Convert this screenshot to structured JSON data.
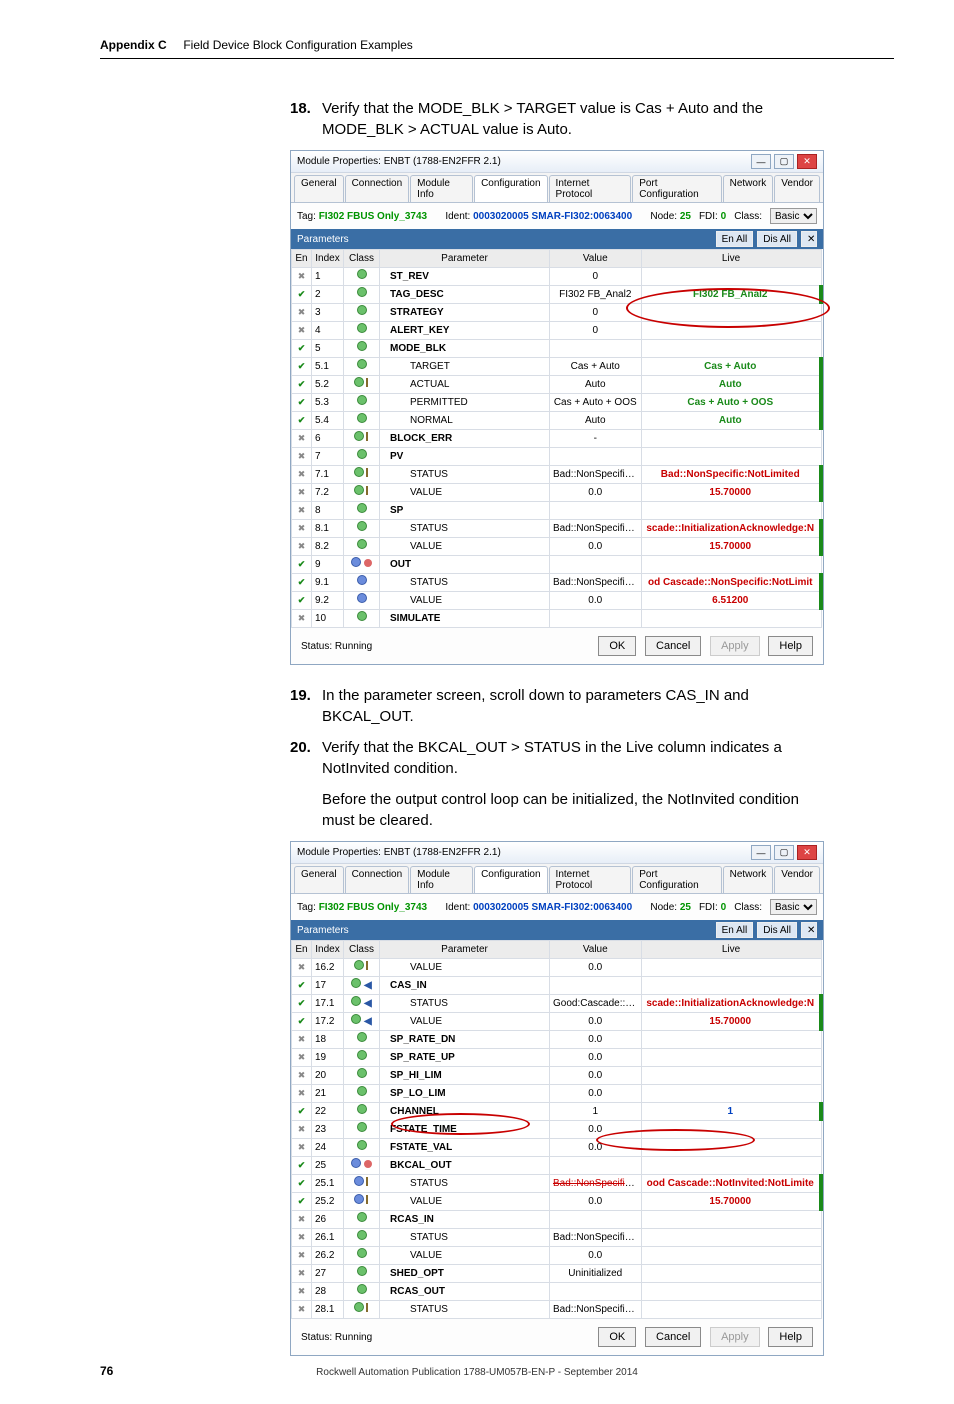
{
  "pageHeader": {
    "appendix": "Appendix C",
    "title": "Field Device Block Configuration Examples"
  },
  "steps": {
    "s18": {
      "num": "18.",
      "text": "Verify that the MODE_BLK > TARGET value is Cas + Auto and the MODE_BLK > ACTUAL value is Auto."
    },
    "s19": {
      "num": "19.",
      "text": "In the parameter screen, scroll down to parameters CAS_IN and BKCAL_OUT."
    },
    "s20": {
      "num": "20.",
      "text": "Verify that the BKCAL_OUT > STATUS in the Live column indicates a NotInvited condition."
    },
    "between": "Before the output control loop can be initialized, the NotInvited condition must be cleared."
  },
  "windowTitle": "Module Properties: ENBT (1788-EN2FFR 2.1)",
  "tabs": [
    "General",
    "Connection",
    "Module Info",
    "Configuration",
    "Internet Protocol",
    "Port Configuration",
    "Network",
    "Vendor"
  ],
  "activeTab": "Configuration",
  "tagBar": {
    "tagLabel": "Tag:",
    "tagValue": "FI302 FBUS Only_3743",
    "identLabel": "Ident:",
    "identValue": "0003020005 SMAR-FI302:0063400",
    "nodeLabel": "Node:",
    "nodeValue": "25",
    "fdiLabel": "FDI:",
    "fdiValue": "0",
    "classLabel": "Class:",
    "classValue": "Basic"
  },
  "paramHeader": {
    "label": "Parameters",
    "enAll": "En All",
    "disAll": "Dis All"
  },
  "gridHeaders": {
    "en": "En",
    "index": "Index",
    "class": "Class",
    "parameter": "Parameter",
    "value": "Value",
    "live": "Live"
  },
  "rows1": [
    {
      "en": "x",
      "idx": "1",
      "cls": "bi",
      "p": "ST_REV",
      "bold": true,
      "indent": 1,
      "val": "0",
      "live": ""
    },
    {
      "en": "v",
      "idx": "2",
      "cls": "bi",
      "p": "TAG_DESC",
      "bold": true,
      "indent": 1,
      "val": "FI302 FB_Anal2",
      "live": "FI302 FB_Anal2",
      "liveCls": "green",
      "bar": true
    },
    {
      "en": "x",
      "idx": "3",
      "cls": "bi",
      "p": "STRATEGY",
      "bold": true,
      "indent": 1,
      "val": "0",
      "live": ""
    },
    {
      "en": "x",
      "idx": "4",
      "cls": "bi",
      "p": "ALERT_KEY",
      "bold": true,
      "indent": 1,
      "val": "0",
      "live": ""
    },
    {
      "en": "v",
      "idx": "5",
      "cls": "bi",
      "p": "MODE_BLK",
      "bold": true,
      "indent": 1,
      "val": "",
      "live": ""
    },
    {
      "en": "v",
      "idx": "5.1",
      "cls": "bi",
      "p": "TARGET",
      "indent": 2,
      "sub": true,
      "val": "Cas + Auto",
      "live": "Cas + Auto",
      "liveCls": "green",
      "bar": true
    },
    {
      "en": "v",
      "idx": "5.2",
      "cls": "bi",
      "p": "ACTUAL",
      "indent": 2,
      "sub": true,
      "pp": true,
      "val": "Auto",
      "live": "Auto",
      "liveCls": "green",
      "bar": true
    },
    {
      "en": "v",
      "idx": "5.3",
      "cls": "bi",
      "p": "PERMITTED",
      "indent": 2,
      "sub": true,
      "val": "Cas + Auto + OOS",
      "live": "Cas + Auto + OOS",
      "liveCls": "green",
      "bar": true
    },
    {
      "en": "v",
      "idx": "5.4",
      "cls": "bi",
      "p": "NORMAL",
      "indent": 2,
      "sub": true,
      "val": "Auto",
      "live": "Auto",
      "liveCls": "green",
      "bar": true
    },
    {
      "en": "x",
      "idx": "6",
      "cls": "bi",
      "p": "BLOCK_ERR",
      "bold": true,
      "indent": 1,
      "pp": true,
      "val": "-",
      "live": ""
    },
    {
      "en": "x",
      "idx": "7",
      "cls": "bi",
      "p": "PV",
      "bold": true,
      "indent": 1,
      "val": "",
      "live": ""
    },
    {
      "en": "x",
      "idx": "7.1",
      "cls": "bi",
      "p": "STATUS",
      "indent": 2,
      "sub": true,
      "pp": true,
      "val": "Bad::NonSpecific:NotLimited",
      "live": "Bad::NonSpecific:NotLimited",
      "liveCls": "red",
      "bar": true
    },
    {
      "en": "x",
      "idx": "7.2",
      "cls": "bi",
      "p": "VALUE",
      "indent": 2,
      "sub": true,
      "pp": true,
      "val": "0.0",
      "live": "15.70000",
      "liveCls": "red",
      "bar": true
    },
    {
      "en": "x",
      "idx": "8",
      "cls": "bi",
      "p": "SP",
      "bold": true,
      "indent": 1,
      "val": "",
      "live": ""
    },
    {
      "en": "x",
      "idx": "8.1",
      "cls": "bi",
      "p": "STATUS",
      "indent": 2,
      "sub": true,
      "val": "Bad::NonSpecific:NotLimited",
      "live": "scade::InitializationAcknowledge:N",
      "liveCls": "red",
      "bar": true
    },
    {
      "en": "x",
      "idx": "8.2",
      "cls": "bi",
      "p": "VALUE",
      "indent": 2,
      "sub": true,
      "val": "0.0",
      "live": "15.70000",
      "liveCls": "red",
      "bar": true
    },
    {
      "en": "v",
      "idx": "9",
      "cls": "bo",
      "p": "OUT",
      "bold": true,
      "indent": 1,
      "rc": true,
      "val": "",
      "live": ""
    },
    {
      "en": "v",
      "idx": "9.1",
      "cls": "bo",
      "p": "STATUS",
      "indent": 2,
      "sub": true,
      "val": "Bad::NonSpecific:NotLimited",
      "live": "od Cascade::NonSpecific:NotLimit",
      "liveCls": "red",
      "bar": true
    },
    {
      "en": "v",
      "idx": "9.2",
      "cls": "bo",
      "p": "VALUE",
      "indent": 2,
      "sub": true,
      "val": "0.0",
      "live": "6.51200",
      "liveCls": "red",
      "bar": true
    },
    {
      "en": "x",
      "idx": "10",
      "cls": "bi",
      "p": "SIMULATE",
      "bold": true,
      "indent": 1,
      "val": "",
      "live": ""
    }
  ],
  "rows2": [
    {
      "en": "x",
      "idx": "16.2",
      "cls": "bi",
      "p": "VALUE",
      "indent": 2,
      "sub": true,
      "pp": true,
      "val": "0.0",
      "live": ""
    },
    {
      "en": "v",
      "idx": "17",
      "cls": "bib",
      "p": "CAS_IN",
      "bold": true,
      "indent": 1,
      "val": "",
      "live": ""
    },
    {
      "en": "v",
      "idx": "17.1",
      "cls": "bib",
      "p": "STATUS",
      "indent": 2,
      "sub": true,
      "val": "Good:Cascade::NonSpecific:NotLimited",
      "live": "scade::InitializationAcknowledge:N",
      "liveCls": "red",
      "bar": true
    },
    {
      "en": "v",
      "idx": "17.2",
      "cls": "bib",
      "p": "VALUE",
      "indent": 2,
      "sub": true,
      "val": "0.0",
      "live": "15.70000",
      "liveCls": "red",
      "bar": true
    },
    {
      "en": "x",
      "idx": "18",
      "cls": "bi",
      "p": "SP_RATE_DN",
      "bold": true,
      "indent": 1,
      "val": "0.0",
      "live": ""
    },
    {
      "en": "x",
      "idx": "19",
      "cls": "bi",
      "p": "SP_RATE_UP",
      "bold": true,
      "indent": 1,
      "val": "0.0",
      "live": ""
    },
    {
      "en": "x",
      "idx": "20",
      "cls": "bi",
      "p": "SP_HI_LIM",
      "bold": true,
      "indent": 1,
      "val": "0.0",
      "live": ""
    },
    {
      "en": "x",
      "idx": "21",
      "cls": "bi",
      "p": "SP_LO_LIM",
      "bold": true,
      "indent": 1,
      "val": "0.0",
      "live": ""
    },
    {
      "en": "v",
      "idx": "22",
      "cls": "bi",
      "p": "CHANNEL",
      "bold": true,
      "indent": 1,
      "val": "1",
      "live": "1",
      "liveCls": "blue",
      "bar": true
    },
    {
      "en": "x",
      "idx": "23",
      "cls": "bi",
      "p": "FSTATE_TIME",
      "bold": true,
      "indent": 1,
      "val": "0.0",
      "live": ""
    },
    {
      "en": "x",
      "idx": "24",
      "cls": "bi",
      "p": "FSTATE_VAL",
      "bold": true,
      "indent": 1,
      "val": "0.0",
      "live": ""
    },
    {
      "en": "v",
      "idx": "25",
      "cls": "bo",
      "p": "BKCAL_OUT",
      "bold": true,
      "indent": 1,
      "rc": true,
      "val": "",
      "live": ""
    },
    {
      "en": "v",
      "idx": "25.1",
      "cls": "bo",
      "p": "STATUS",
      "indent": 2,
      "sub": true,
      "pp": true,
      "val": "Bad::NonSpecific:NotLim",
      "strike": true,
      "live": "ood Cascade::NotInvited:NotLimite",
      "liveCls": "red",
      "bar": true
    },
    {
      "en": "v",
      "idx": "25.2",
      "cls": "bo",
      "p": "VALUE",
      "indent": 2,
      "sub": true,
      "pp": true,
      "val": "0.0",
      "live": "15.70000",
      "liveCls": "red",
      "bar": true
    },
    {
      "en": "x",
      "idx": "26",
      "cls": "bi",
      "p": "RCAS_IN",
      "bold": true,
      "indent": 1,
      "val": "",
      "live": ""
    },
    {
      "en": "x",
      "idx": "26.1",
      "cls": "bi",
      "p": "STATUS",
      "indent": 2,
      "sub": true,
      "val": "Bad::NonSpecific:NotLimited",
      "live": ""
    },
    {
      "en": "x",
      "idx": "26.2",
      "cls": "bi",
      "p": "VALUE",
      "indent": 2,
      "sub": true,
      "val": "0.0",
      "live": ""
    },
    {
      "en": "x",
      "idx": "27",
      "cls": "bi",
      "p": "SHED_OPT",
      "bold": true,
      "indent": 1,
      "val": "Uninitialized",
      "live": ""
    },
    {
      "en": "x",
      "idx": "28",
      "cls": "bi",
      "p": "RCAS_OUT",
      "bold": true,
      "indent": 1,
      "val": "",
      "live": ""
    },
    {
      "en": "x",
      "idx": "28.1",
      "cls": "bi",
      "p": "STATUS",
      "indent": 2,
      "sub": true,
      "pp": true,
      "val": "Bad::NonSpecific:NotLimited",
      "live": ""
    }
  ],
  "dialogFooter": {
    "status": "Status: Running",
    "ok": "OK",
    "cancel": "Cancel",
    "apply": "Apply",
    "help": "Help"
  },
  "pageFooter": {
    "pageNum": "76",
    "pub": "Rockwell Automation Publication 1788-UM057B-EN-P - September 2014"
  }
}
